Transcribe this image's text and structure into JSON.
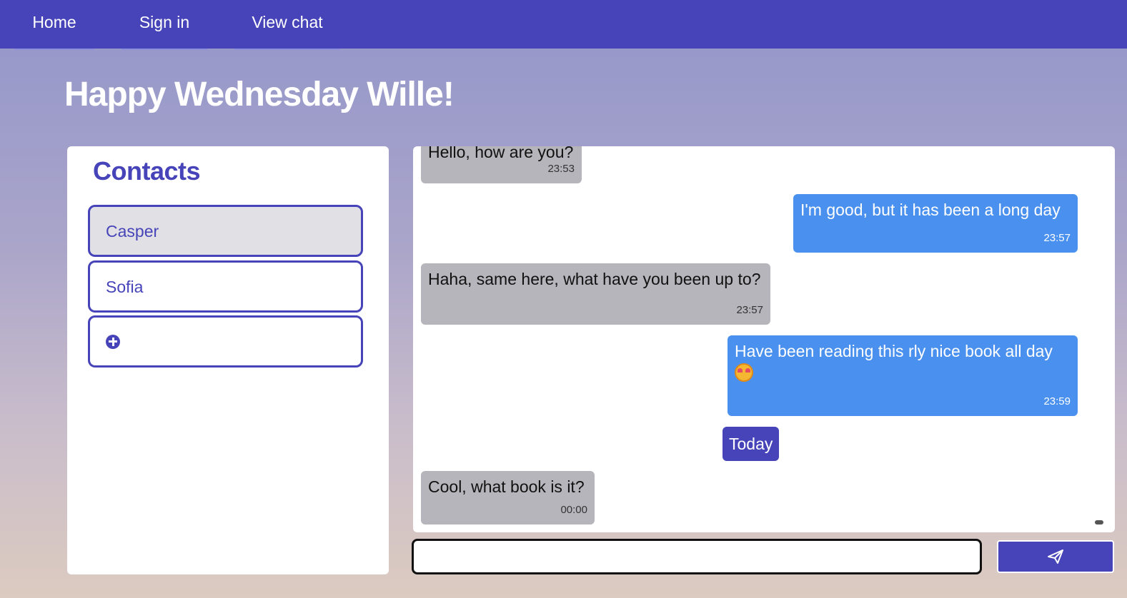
{
  "nav": {
    "home": "Home",
    "sign_in": "Sign in",
    "view_chat": "View chat"
  },
  "greeting": "Happy Wednesday Wille!",
  "contacts": {
    "heading": "Contacts",
    "items": [
      {
        "name": "Casper",
        "active": true
      },
      {
        "name": "Sofia",
        "active": false
      }
    ],
    "add_icon": "plus-circle-icon"
  },
  "chat": {
    "messages": [
      {
        "direction": "incoming",
        "text": "Hello, how are you?",
        "time": "23:53"
      },
      {
        "direction": "outgoing",
        "text": "I'm good, but it has been a long day",
        "time": "23:57"
      },
      {
        "direction": "incoming",
        "text": "Haha, same here, what have you been up to?",
        "time": "23:57"
      },
      {
        "direction": "outgoing",
        "text": "Have been reading this rly nice book all day",
        "emoji": "smiling-face-with-hearts",
        "time": "23:59"
      },
      {
        "direction": "incoming",
        "text": "Cool, what book is it?",
        "time": "00:00"
      }
    ],
    "date_separator": "Today"
  },
  "composer": {
    "input_value": "",
    "send_icon": "paper-plane-icon"
  },
  "colors": {
    "primary": "#4644b8",
    "outgoing_bubble": "#4a90ee",
    "incoming_bubble": "#b5b5bb",
    "active_contact": "#e1e1e5"
  }
}
